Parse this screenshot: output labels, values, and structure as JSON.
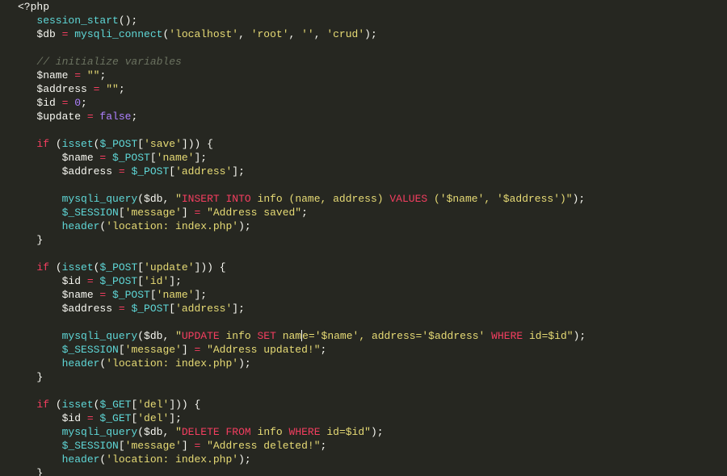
{
  "line0": "<?php",
  "fn": {
    "session_start": "session_start",
    "mysqli_connect": "mysqli_connect",
    "isset": "isset",
    "mysqli_query": "mysqli_query",
    "header": "header"
  },
  "vars": {
    "db": "$db",
    "name": "$name",
    "address": "$address",
    "id": "$id",
    "update": "$update"
  },
  "globals": {
    "POST": "$_POST",
    "GET": "$_GET",
    "SESSION": "$_SESSION"
  },
  "cmt": {
    "init": "// initialize variables"
  },
  "str": {
    "localhost": "'localhost'",
    "root": "'root'",
    "empty": "''",
    "crud": "'crud'",
    "dq_empty": "\"\"",
    "save": "'save'",
    "name": "'name'",
    "address": "'address'",
    "update": "'update'",
    "id": "'id'",
    "del": "'del'",
    "message": "'message'",
    "insert_pre": "\"",
    "insert_sql1": "INSERT",
    "insert_sql2": "INTO",
    "tbl_info": " info (name, address) ",
    "values_kw": "VALUES",
    "insert_post": " ('$name', '$address')\"",
    "saved": "\"Address saved\"",
    "loc": "'location: index.php'",
    "update_sql1": "UPDATE",
    "update_tbl": " info ",
    "set_kw": "SET",
    "update_fields1": " nam",
    "update_fields2": "e='$name', address='$address' ",
    "where_kw": "WHERE",
    "update_where": " id=$id\"",
    "updated": "\"Address updated!\"",
    "delete_sql1": "DELETE",
    "delete_sql2": "FROM",
    "delete_tbl": " info ",
    "delete_where": " id=$id\"",
    "deleted": "\"Address deleted!\""
  },
  "num": {
    "zero": "0"
  },
  "bool": {
    "false": "false"
  },
  "kw": {
    "if": "if"
  },
  "punc": {
    "op": "(",
    "cp": ")",
    "ob": "{",
    "cb": "}",
    "osb": "[",
    "csb": "]",
    "sc": ";",
    "comma": ", ",
    "eq": " = "
  }
}
